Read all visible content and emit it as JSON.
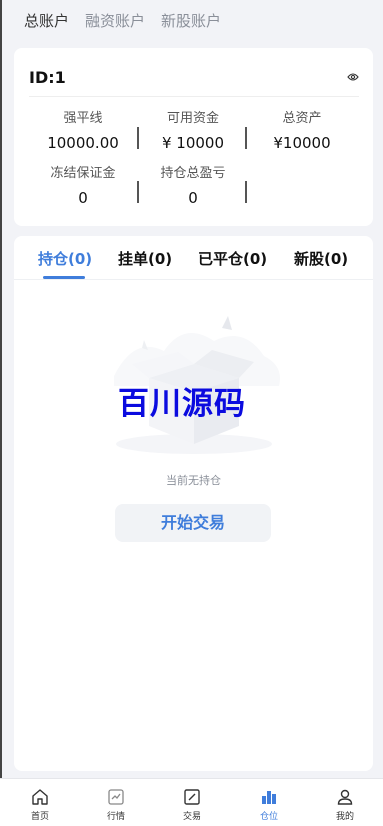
{
  "top_tabs": [
    "总账户",
    "融资账户",
    "新股账户"
  ],
  "account": {
    "id_label": "ID:1",
    "stats": [
      {
        "label": "强平线",
        "value": "10000.00"
      },
      {
        "label": "可用资金",
        "value": "¥ 10000"
      },
      {
        "label": "总资产",
        "value": "¥10000"
      },
      {
        "label": "冻结保证金",
        "value": "0"
      },
      {
        "label": "持仓总盈亏",
        "value": "0"
      }
    ]
  },
  "position_tabs": [
    "持仓(0)",
    "挂单(0)",
    "已平仓(0)",
    "新股(0)"
  ],
  "active_position_tab": 0,
  "watermark_text": "百川源码",
  "empty_text": "当前无持仓",
  "start_button_label": "开始交易",
  "tabbar": [
    {
      "label": "首页",
      "icon": "home-icon"
    },
    {
      "label": "行情",
      "icon": "chart-icon"
    },
    {
      "label": "交易",
      "icon": "trade-icon"
    },
    {
      "label": "仓位",
      "icon": "bar-chart-icon"
    },
    {
      "label": "我的",
      "icon": "user-icon"
    }
  ],
  "active_tab": 3,
  "colors": {
    "accent": "#3f7ddb",
    "watermark": "#0b0bdf"
  }
}
